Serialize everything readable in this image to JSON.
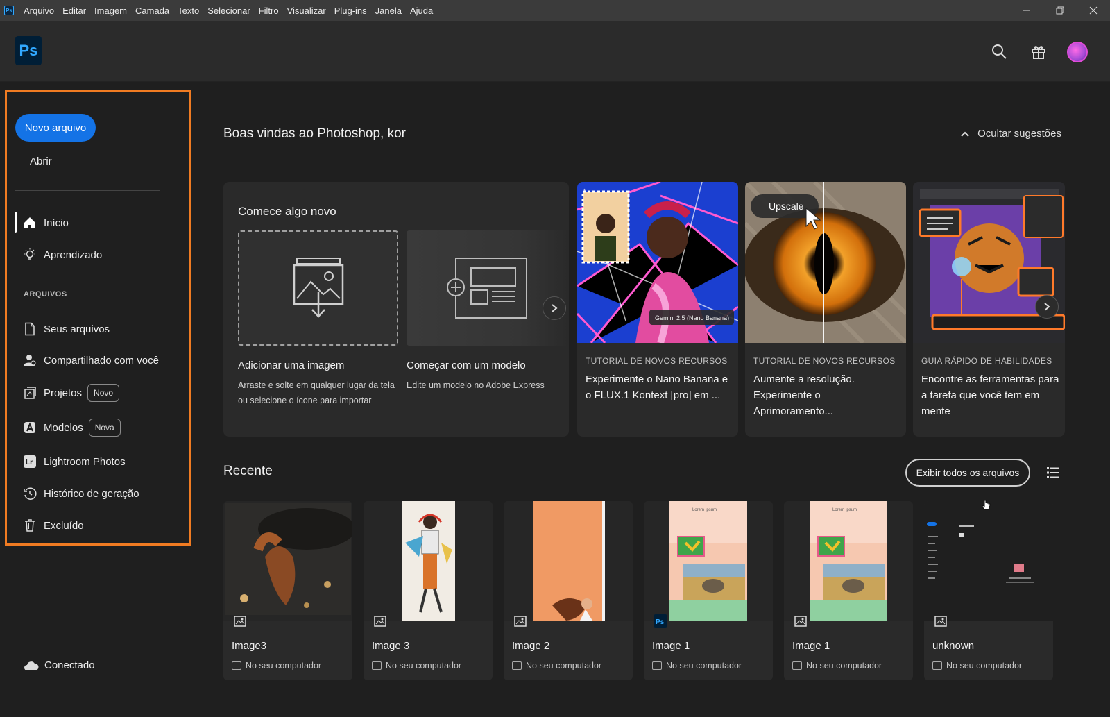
{
  "menubar": {
    "app_icon": "ps-mini-icon",
    "items": [
      "Arquivo",
      "Editar",
      "Imagem",
      "Camada",
      "Texto",
      "Selecionar",
      "Filtro",
      "Visualizar",
      "Plug-ins",
      "Janela",
      "Ajuda"
    ],
    "window_controls": [
      "minimize",
      "restore",
      "close"
    ]
  },
  "header": {
    "logo_text": "Ps",
    "icons": [
      "search-icon",
      "gift-icon"
    ],
    "accent_color": "#1473e6",
    "highlight_color": "#f07b22"
  },
  "sidebar": {
    "new_file": "Novo arquivo",
    "open": "Abrir",
    "nav": [
      {
        "label": "Início",
        "icon": "home-icon",
        "active": true
      },
      {
        "label": "Aprendizado",
        "icon": "lightbulb-icon"
      }
    ],
    "section_label": "ARQUIVOS",
    "files_nav": [
      {
        "label": "Seus arquivos",
        "icon": "file-icon"
      },
      {
        "label": "Compartilhado com você",
        "icon": "shared-user-icon"
      },
      {
        "label": "Projetos",
        "icon": "projects-icon",
        "badge": "Novo"
      },
      {
        "label": "Modelos",
        "icon": "templates-icon",
        "badge": "Nova"
      },
      {
        "label": "Lightroom Photos",
        "icon": "lightroom-icon"
      },
      {
        "label": "Histórico de geração",
        "icon": "history-icon"
      },
      {
        "label": "Excluído",
        "icon": "trash-icon"
      }
    ],
    "status": "Conectado"
  },
  "main": {
    "welcome": "Boas vindas ao Photoshop, kor",
    "hide_suggestions": "Ocultar sugestões",
    "start": {
      "title": "Comece algo novo",
      "cards": [
        {
          "title": "Adicionar uma imagem",
          "desc": "Arraste e solte em qualquer lugar da tela ou selecione o ícone para importar"
        },
        {
          "title": "Começar com um modelo",
          "desc": "Edite um modelo no Adobe Express"
        }
      ]
    },
    "suggestions": [
      {
        "kicker": "TUTORIAL DE NOVOS RECURSOS",
        "title": "Experimente o Nano Banana e o FLUX.1 Kontext [pro] em ...",
        "chip": "Gemini 2.5 (Nano Banana)"
      },
      {
        "kicker": "TUTORIAL DE NOVOS RECURSOS",
        "title": "Aumente a resolução. Experimente o Aprimoramento...",
        "chip": "Upscale"
      },
      {
        "kicker": "GUIA RÁPIDO DE HABILIDADES",
        "title": "Encontre as ferramentas para a tarefa que você tem em mente"
      }
    ],
    "recent": {
      "title": "Recente",
      "view_all": "Exibir todos os arquivos",
      "files": [
        {
          "name": "Image3",
          "location": "No seu computador",
          "badge": "image-icon"
        },
        {
          "name": "Image 3",
          "location": "No seu computador",
          "badge": "image-icon"
        },
        {
          "name": "Image 2",
          "location": "No seu computador",
          "badge": "image-icon"
        },
        {
          "name": "Image 1",
          "location": "No seu computador",
          "badge": "ps-file-icon"
        },
        {
          "name": "Image 1",
          "location": "No seu computador",
          "badge": "image-icon"
        },
        {
          "name": "unknown",
          "location": "No seu computador",
          "badge": "image-icon"
        }
      ]
    }
  }
}
